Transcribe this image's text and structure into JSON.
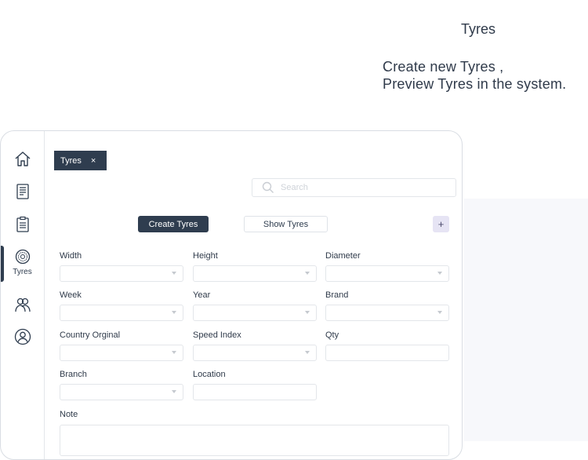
{
  "hero": {
    "title": "Tyres",
    "line1": "Create new Tyres ,",
    "line2": "Preview Tyres in the system."
  },
  "sidebar": {
    "items": [
      {
        "name": "home",
        "icon": "home-icon"
      },
      {
        "name": "invoice",
        "icon": "receipt-icon"
      },
      {
        "name": "orders",
        "icon": "clipboard-icon"
      },
      {
        "name": "tyres",
        "icon": "tyre-icon",
        "label": "Tyres",
        "active": true
      },
      {
        "name": "customers",
        "icon": "users-icon"
      },
      {
        "name": "profile",
        "icon": "user-circle-icon"
      }
    ]
  },
  "tab": {
    "label": "Tyres",
    "close": "×"
  },
  "search": {
    "placeholder": "Search",
    "value": ""
  },
  "actions": {
    "create_label": "Create Tyres",
    "show_label": "Show Tyres",
    "add_label": "+"
  },
  "form": {
    "width_label": "Width",
    "height_label": "Height",
    "diameter_label": "Diameter",
    "week_label": "Week",
    "year_label": "Year",
    "brand_label": "Brand",
    "country_label": "Country Orginal",
    "speed_label": "Speed Index",
    "qty_label": "Qty",
    "branch_label": "Branch",
    "location_label": "Location",
    "note_label": "Note"
  },
  "colors": {
    "primary": "#2f3d4f",
    "accent_soft": "#e6e4f4",
    "border": "#e3e6ea"
  }
}
